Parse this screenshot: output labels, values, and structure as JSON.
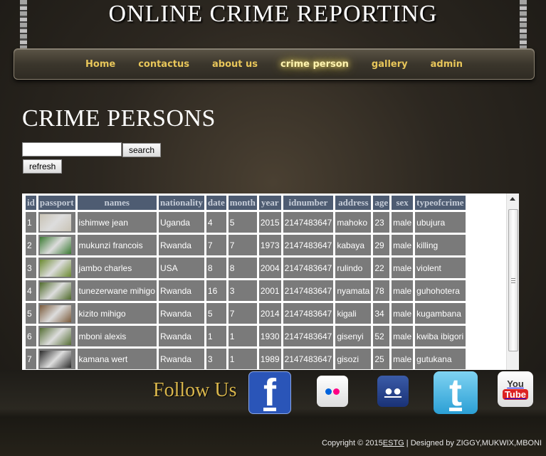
{
  "site": {
    "title": "ONLINE CRIME REPORTING"
  },
  "nav": {
    "items": [
      "Home",
      "contactus",
      "about us",
      "crime person",
      "gallery",
      "admin"
    ],
    "active": 3
  },
  "page": {
    "heading": "CRIME PERSONS"
  },
  "search": {
    "value": "",
    "button_label": "search",
    "refresh_label": "refresh"
  },
  "table": {
    "headers": [
      "id",
      "passport",
      "names",
      "nationality",
      "date",
      "month",
      "year",
      "idnumber",
      "address",
      "age",
      "sex",
      "typeofcrime"
    ],
    "rows": [
      [
        "1",
        "",
        "ishimwe jean",
        "Uganda",
        "4",
        "5",
        "2015",
        "2147483647",
        "mahoko",
        "23",
        "male",
        "ubujura"
      ],
      [
        "2",
        "",
        "mukunzi francois",
        "Rwanda",
        "7",
        "7",
        "1973",
        "2147483647",
        "kabaya",
        "29",
        "male",
        "killing"
      ],
      [
        "3",
        "",
        "jambo charles",
        "USA",
        "8",
        "8",
        "2004",
        "2147483647",
        "rulindo",
        "22",
        "male",
        "violent"
      ],
      [
        "4",
        "",
        "tunezerwane mihigo",
        "Rwanda",
        "16",
        "3",
        "2001",
        "2147483647",
        "nyamata",
        "78",
        "male",
        "guhohotera"
      ],
      [
        "5",
        "",
        "kizito mihigo",
        "Rwanda",
        "5",
        "7",
        "2014",
        "2147483647",
        "kigali",
        "34",
        "male",
        "kugambana"
      ],
      [
        "6",
        "",
        "mboni alexis",
        "Rwanda",
        "1",
        "1",
        "1930",
        "2147483647",
        "gisenyi",
        "52",
        "male",
        "kwiba ibigori"
      ],
      [
        "7",
        "",
        "kamana wert",
        "Rwanda",
        "3",
        "1",
        "1989",
        "2147483647",
        "gisozi",
        "25",
        "male",
        "gutukana"
      ]
    ],
    "thumb_colors": [
      "#c9c3b5",
      "#3a7a32",
      "#6b8a30",
      "#4f6a2a",
      "#7a5a3a",
      "#556e34",
      "#2a2a2a"
    ]
  },
  "footer": {
    "follow_label": "Follow Us",
    "social": [
      "facebook-icon",
      "flickr-icon",
      "myspace-icon",
      "twitter-icon",
      "youtube-icon"
    ],
    "fb_glyph": "f",
    "twitter_glyph": "t",
    "youtube_you": "You",
    "youtube_tube": "Tube",
    "copyright_prefix": "Copyright © 2015",
    "copyright_link": "ESTG",
    "copyright_suffix": " | Designed by ZIGGY,MUKWIX,MBONI"
  }
}
